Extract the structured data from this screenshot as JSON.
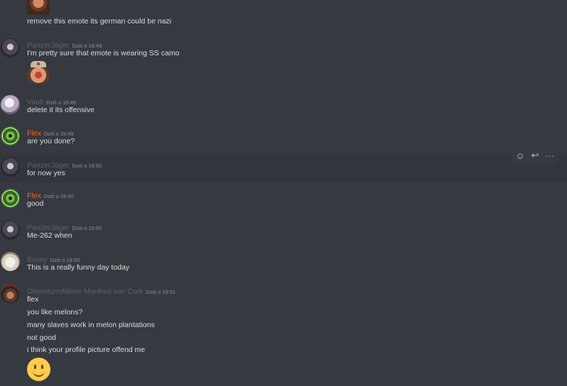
{
  "messages": [
    {
      "id": "m0",
      "avatar": null,
      "lines": [
        "remove this emote its german could be nazi"
      ],
      "emote": "man-face-emote"
    },
    {
      "id": "m1",
      "author": "PanzerJäger",
      "timestamp": "Dziś o 19:49",
      "avatar": "panzer",
      "lines": [
        "I'm pretty sure that emote is wearing SS camo"
      ],
      "emote": "laughing-soldier-emote"
    },
    {
      "id": "m2",
      "author": "Vault",
      "timestamp": "Dziś o 19:49",
      "avatar": "vault",
      "lines": [
        "delete it its offensive"
      ]
    },
    {
      "id": "m3",
      "author": "Flex",
      "author_color": "#f26522",
      "timestamp": "Dziś o 19:49",
      "avatar": "flex",
      "lines": [
        "are you done?"
      ]
    },
    {
      "id": "m4",
      "author": "PanzerJäger",
      "timestamp": "Dziś o 19:50",
      "avatar": "panzer",
      "lines": [
        "for now yes"
      ],
      "hovered": true
    },
    {
      "id": "m5",
      "author": "Flex",
      "author_color": "#f26522",
      "timestamp": "Dziś o 19:50",
      "avatar": "flex",
      "lines": [
        "good"
      ]
    },
    {
      "id": "m6",
      "author": "PanzerJäger",
      "timestamp": "Dziś o 19:50",
      "avatar": "panzer",
      "lines": [
        "Me-262 when"
      ]
    },
    {
      "id": "m7",
      "author": "Buxxy",
      "timestamp": "Dziś o 19:50",
      "avatar": "buxxy",
      "lines": [
        "This is a really funny day today"
      ]
    },
    {
      "id": "m8",
      "author": "Obersturmführer Manfred von Cork",
      "timestamp": "Dziś o 19:51",
      "avatar": "cork",
      "lines": [
        "flex",
        "you like melons?",
        "many slaves work in melon plantations",
        "not good",
        "i think your profile picture offend me"
      ],
      "emoji": "slightly-smiling-face"
    }
  ],
  "toolbar": {
    "icons": [
      "add-reaction-icon",
      "reply-icon",
      "more-options-icon"
    ],
    "more_glyph": "···",
    "reply_glyph": "↩",
    "react_glyph": "☺"
  },
  "colors": {
    "background": "#36393f",
    "hover_background": "#32353b",
    "text": "#dcddde",
    "username_default": "#5f6268",
    "username_flex": "#f26522",
    "timestamp": "#8e9297"
  }
}
